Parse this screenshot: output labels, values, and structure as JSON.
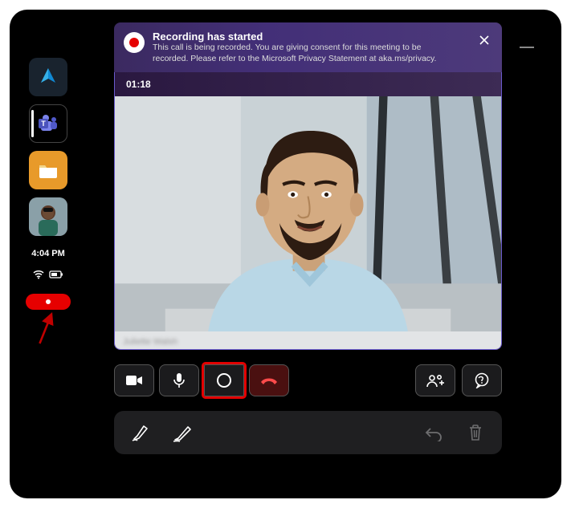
{
  "banner": {
    "title": "Recording has started",
    "text": "This call is being recorded. You are giving consent for this meeting to be recorded. Please refer to the Microsoft Privacy Statement at aka.ms/privacy."
  },
  "call": {
    "timer": "01:18",
    "participant_name": "Juliette Walsh"
  },
  "status": {
    "time": "4:04 PM"
  },
  "sidebar": {
    "apps": [
      "dynamics",
      "teams",
      "files",
      "avatar"
    ]
  },
  "controls": {
    "camera": "camera",
    "mic": "mic",
    "record": "record",
    "hangup": "hangup",
    "people": "people",
    "chat": "chat"
  },
  "bottombar": {
    "highlighter": "highlighter",
    "pen": "pen",
    "undo": "undo",
    "delete": "delete"
  }
}
